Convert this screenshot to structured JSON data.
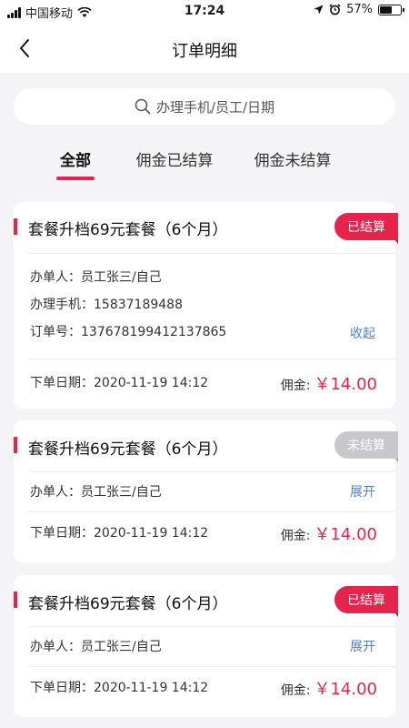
{
  "status_bar": {
    "carrier": "中国移动",
    "time": "17:24",
    "battery": "57%",
    "battery_level": 0.57,
    "icons": [
      "signal-icon",
      "wifi-icon",
      "location-icon",
      "alarm-icon",
      "battery-icon"
    ]
  },
  "nav": {
    "title": "订单明细",
    "back_icon": "chevron-left-icon"
  },
  "search": {
    "placeholder": "办理手机/员工/日期",
    "icon": "search-icon"
  },
  "tabs": [
    {
      "label": "全部",
      "active": true
    },
    {
      "label": "佣金已结算",
      "active": false
    },
    {
      "label": "佣金未结算",
      "active": false
    }
  ],
  "colors": {
    "accent": "#e5234b",
    "link": "#4a83c6",
    "pending_badge": "#c8c8cc"
  },
  "orders": [
    {
      "title": "套餐升档69元套餐（6个月）",
      "status": "已结算",
      "handler_label": "办单人：",
      "handler": "员工张三/自己",
      "phone_label": "办理手机：",
      "phone": "15837189488",
      "order_no_label": "订单号：",
      "order_no": "137678199412137865",
      "action": "收起",
      "date_label": "下单日期：",
      "date": "2020-11-19  14:12",
      "commission_label": "佣金:",
      "commission": "￥14.00"
    },
    {
      "title": "套餐升档69元套餐（6个月）",
      "status": "未结算",
      "handler_label": "办单人：",
      "handler": "员工张三/自己",
      "action": "展开",
      "date_label": "下单日期：",
      "date": "2020-11-19  14:12",
      "commission_label": "佣金:",
      "commission": "￥14.00"
    },
    {
      "title": "套餐升档69元套餐（6个月）",
      "status": "已结算",
      "handler_label": "办单人：",
      "handler": "员工张三/自己",
      "action": "展开",
      "date_label": "下单日期：",
      "date": "2020-11-19  14:12",
      "commission_label": "佣金:",
      "commission": "￥14.00"
    }
  ]
}
